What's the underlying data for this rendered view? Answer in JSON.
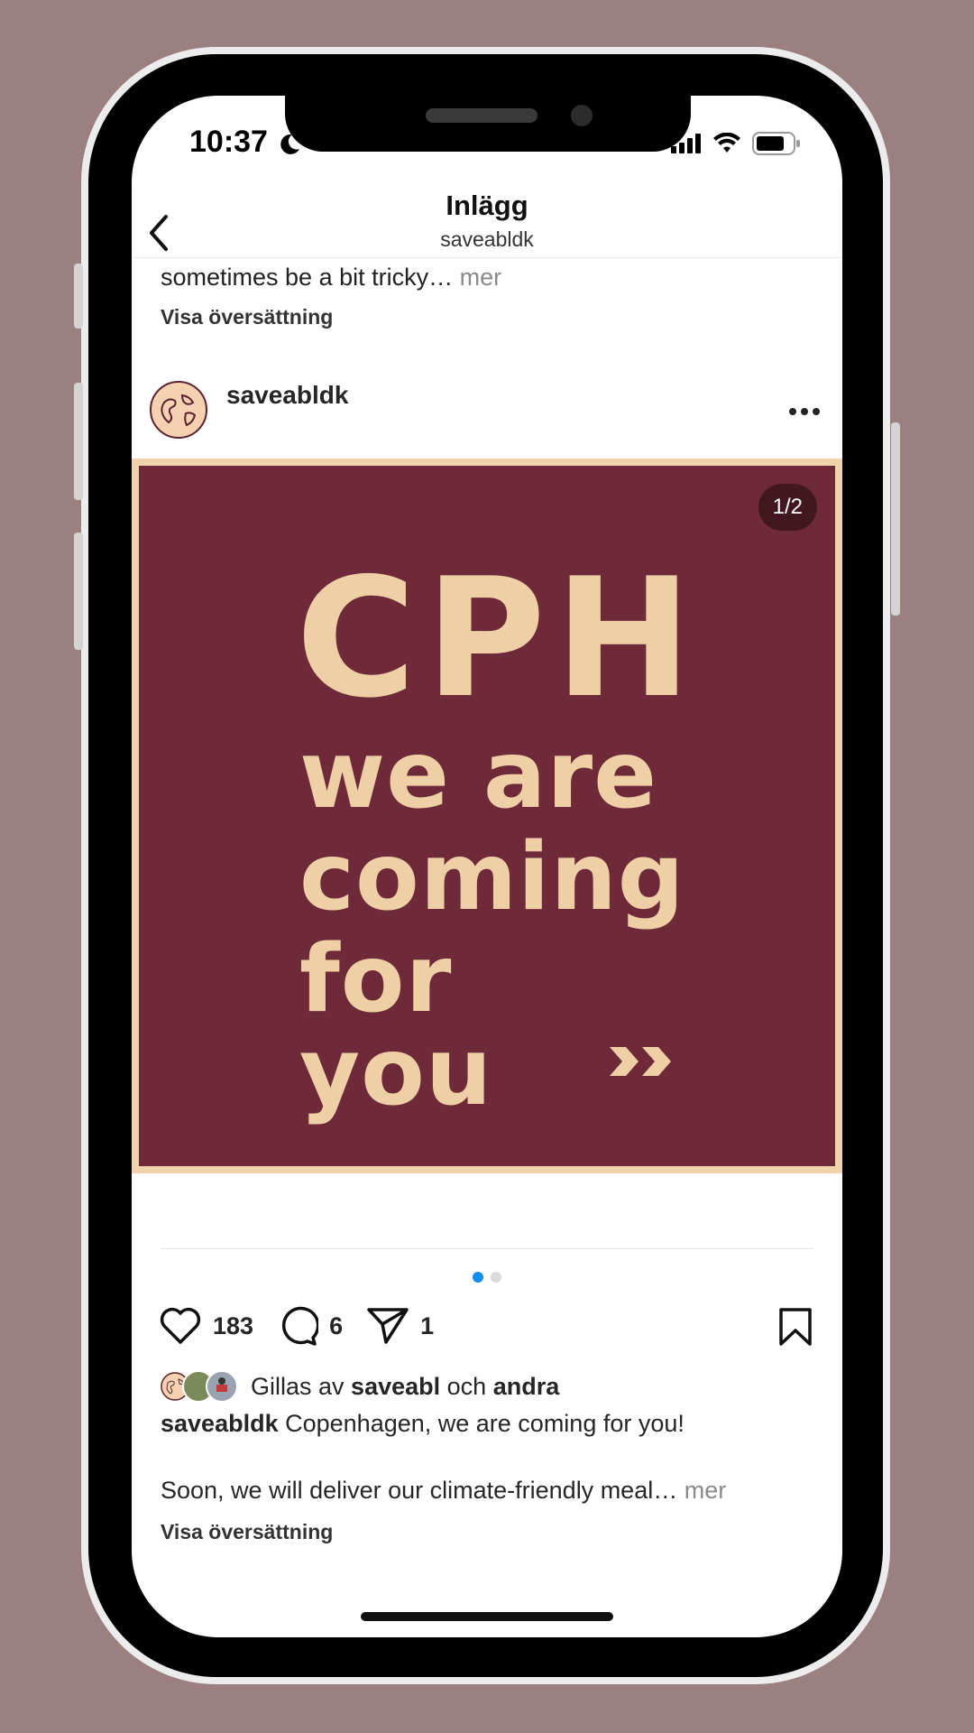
{
  "status_bar": {
    "time": "10:37"
  },
  "nav": {
    "title": "Inlägg",
    "subtitle": "saveabldk"
  },
  "previous_post": {
    "caption": "sometimes be a bit tricky…",
    "more": "mer",
    "translate": "Visa översättning"
  },
  "post": {
    "username": "saveabldk",
    "counter": "1/2",
    "image_text": {
      "line1": "CPH",
      "line2": "we are",
      "line3": "coming",
      "line4": "for you"
    },
    "likes": "183",
    "comments": "6",
    "shares": "1",
    "liked_by_prefix": "Gillas av",
    "liked_by_user": "saveabl",
    "liked_by_and": "och",
    "liked_by_other": "andra",
    "caption_user": "saveabldk",
    "caption_text": "Copenhagen, we are coming for you!",
    "caption_line2": "Soon, we will deliver our climate-friendly meal…",
    "more": "mer",
    "translate": "Visa översättning"
  },
  "colors": {
    "page_bg": "#9c7f80",
    "image_bg": "#6e2a39",
    "image_text": "#eecfa6",
    "active_dot": "#0f8ff0"
  }
}
